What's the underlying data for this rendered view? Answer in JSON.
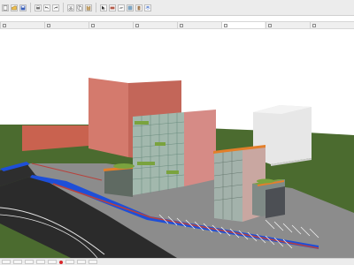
{
  "toolbar": {
    "icons": [
      "new-icon",
      "open-icon",
      "save-icon",
      "print-icon",
      "undo-icon",
      "redo-icon",
      "cut-icon",
      "copy-icon",
      "paste-icon",
      "select-icon",
      "wall-icon",
      "slab-icon",
      "window-icon",
      "door-icon",
      "layers-icon"
    ]
  },
  "tabs": [
    "",
    "",
    "",
    "",
    "",
    "",
    "",
    ""
  ],
  "viewport": {
    "colors": {
      "grass": "#4b6b2f",
      "road": "#2b2b2b",
      "pavement": "#8a8a8a",
      "water": "#1e4fd8",
      "brick": "#d3695a",
      "glass": "#8fb5a7",
      "white_building": "#e6e6e6",
      "orange_trim": "#e37f2a"
    }
  },
  "status": {
    "items": [
      "",
      "",
      "",
      "",
      "",
      "",
      "",
      ""
    ]
  }
}
